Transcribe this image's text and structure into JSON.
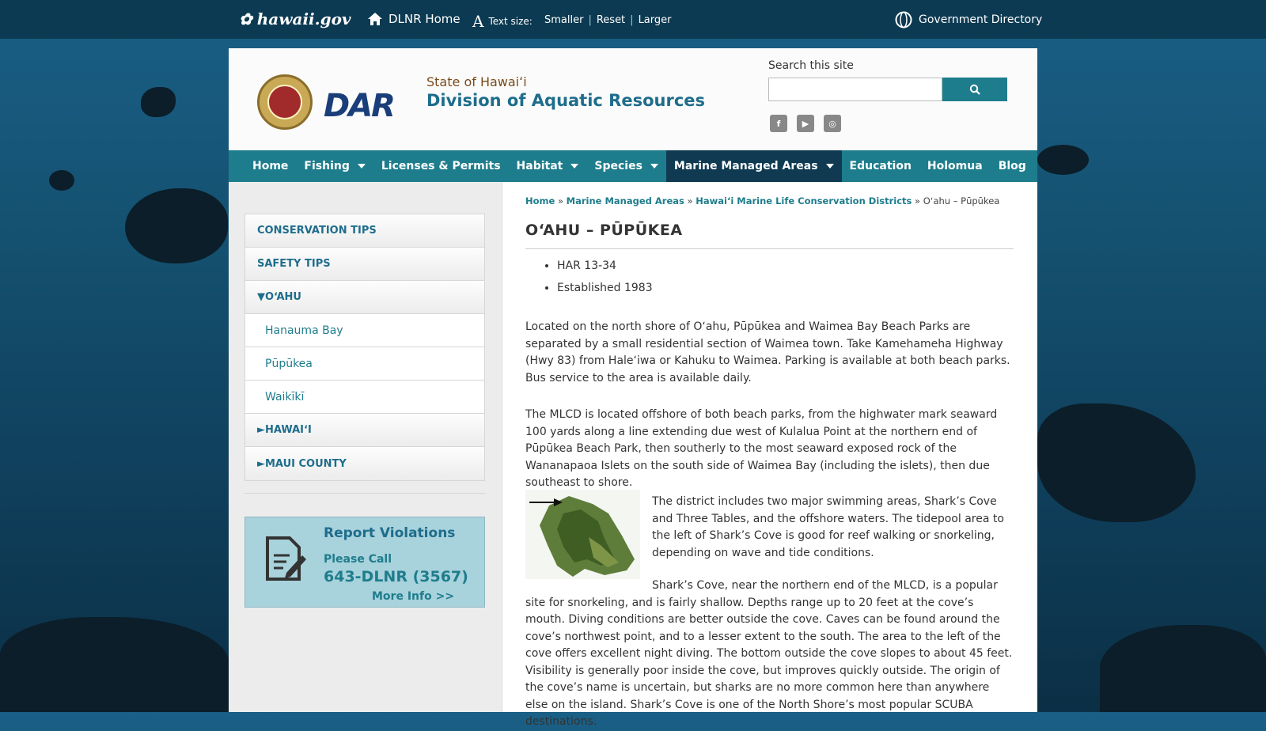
{
  "topbar": {
    "logo": "hawaii.gov",
    "dlnr_home": "DLNR Home",
    "text_size_label": "Text size:",
    "smaller": "Smaller",
    "reset": "Reset",
    "larger": "Larger",
    "sep": "|",
    "gov_directory": "Government Directory"
  },
  "header": {
    "state": "State of Hawaiʻi",
    "division": "Division of Aquatic Resources",
    "search_label": "Search this site",
    "search_value": ""
  },
  "nav": {
    "items": [
      "Home",
      "Fishing",
      "Licenses & Permits",
      "Habitat",
      "Species",
      "Marine Managed Areas",
      "Education",
      "Holomua",
      "Blog"
    ]
  },
  "sidebar": {
    "items": [
      "CONSERVATION TIPS",
      "SAFETY TIPS",
      "▼OʻAHU",
      "Hanauma Bay",
      "Pūpūkea",
      "Waikīkī",
      "►HAWAIʻI",
      "►MAUI COUNTY"
    ],
    "report_title": "Report Violations",
    "report_call": "Please Call",
    "report_phone": "643-DLNR (3567)",
    "report_more": "More Info >>"
  },
  "main": {
    "breadcrumb": [
      "Home",
      "Marine Managed Areas",
      "Hawaiʻi Marine Life Conservation Districts",
      "Oʻahu – Pūpūkea"
    ],
    "breadcrumb_sep": "»",
    "title": "OʻAHU – PŪPŪKEA",
    "bullets": [
      "HAR 13-34",
      "Established 1983"
    ],
    "paragraphs": [
      "Located on the north shore of Oʻahu, Pūpūkea and Waimea Bay Beach Parks are separated by a small residential section of Waimea town. Take Kamehameha Highway (Hwy 83) from Haleʻiwa or Kahuku to Waimea. Parking is available at both beach parks. Bus service to the area is available daily.",
      "The MLCD is located offshore of both beach parks, from the highwater mark seaward 100 yards along a line extending due west of Kulalua Point at the northern end of Pūpūkea Beach Park, then southerly to the most seaward exposed rock of the Wananapaoa Islets on the south side of Waimea Bay (including the islets), then due southeast to shore.",
      "The district includes two major swimming areas, Shark’s Cove and Three Tables, and the offshore waters. The tidepool area to the left of Shark’s Cove is good for reef walking or snorkeling, depending on wave and tide conditions.",
      "Shark’s Cove, near the northern end of the MLCD, is a popular site for snorkeling, and is fairly shallow. Depths range up to 20 feet at the cove’s mouth. Diving conditions are better outside the cove. Caves can be found around the cove’s northwest point, and to a lesser extent to the south. The area to the left of the cove offers excellent night diving. The bottom outside the cove slopes to about 45 feet. Visibility is generally poor inside the cove, but improves quickly outside. The origin of the cove’s name is uncertain, but sharks are no more common here than anywhere else on the island. Shark’s Cove is one of the North Shore’s most popular SCUBA destinations."
    ]
  },
  "colors": {
    "topbar": "#0c3a52",
    "accent": "#1e7d8c",
    "nav_active": "#0f3a52",
    "report_bg": "#a8d2dc"
  },
  "icons": [
    "flower-icon",
    "home-icon",
    "text-size-icon",
    "globe-icon",
    "search-icon",
    "facebook-icon",
    "youtube-icon",
    "instagram-icon",
    "report-doc-icon"
  ]
}
